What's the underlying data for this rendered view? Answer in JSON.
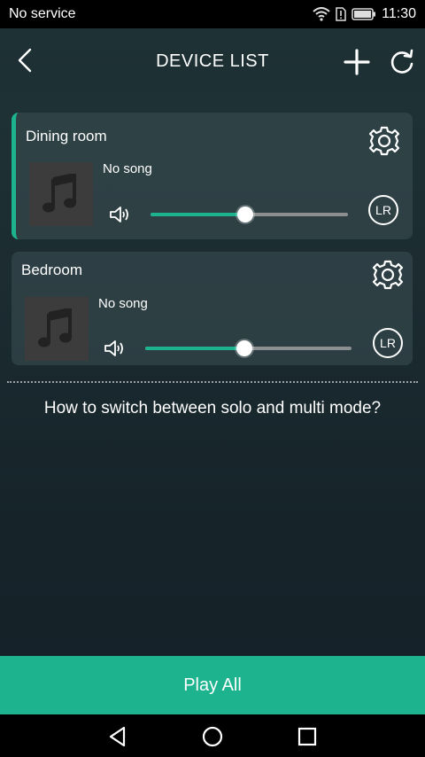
{
  "status_bar": {
    "carrier": "No service",
    "time": "11:30",
    "icons": [
      "wifi-icon",
      "sim-alert-icon",
      "battery-icon"
    ]
  },
  "header": {
    "title": "DEVICE LIST",
    "icons": [
      "back-arrow-icon",
      "plus-icon",
      "refresh-icon"
    ]
  },
  "devices": [
    {
      "name": "Dining room",
      "song": "No song",
      "volume_percent": 48,
      "channel": "LR",
      "selected": true
    },
    {
      "name": "Bedroom",
      "song": "No song",
      "volume_percent": 48,
      "channel": "LR",
      "selected": false
    }
  ],
  "help_text": "How to switch between solo and multi mode?",
  "play_all_label": "Play All",
  "nav_bar": {
    "icons": [
      "back-triangle-icon",
      "home-circle-icon",
      "recents-square-icon"
    ]
  },
  "colors": {
    "accent": "#1db38f",
    "background": "#1c2c31"
  }
}
